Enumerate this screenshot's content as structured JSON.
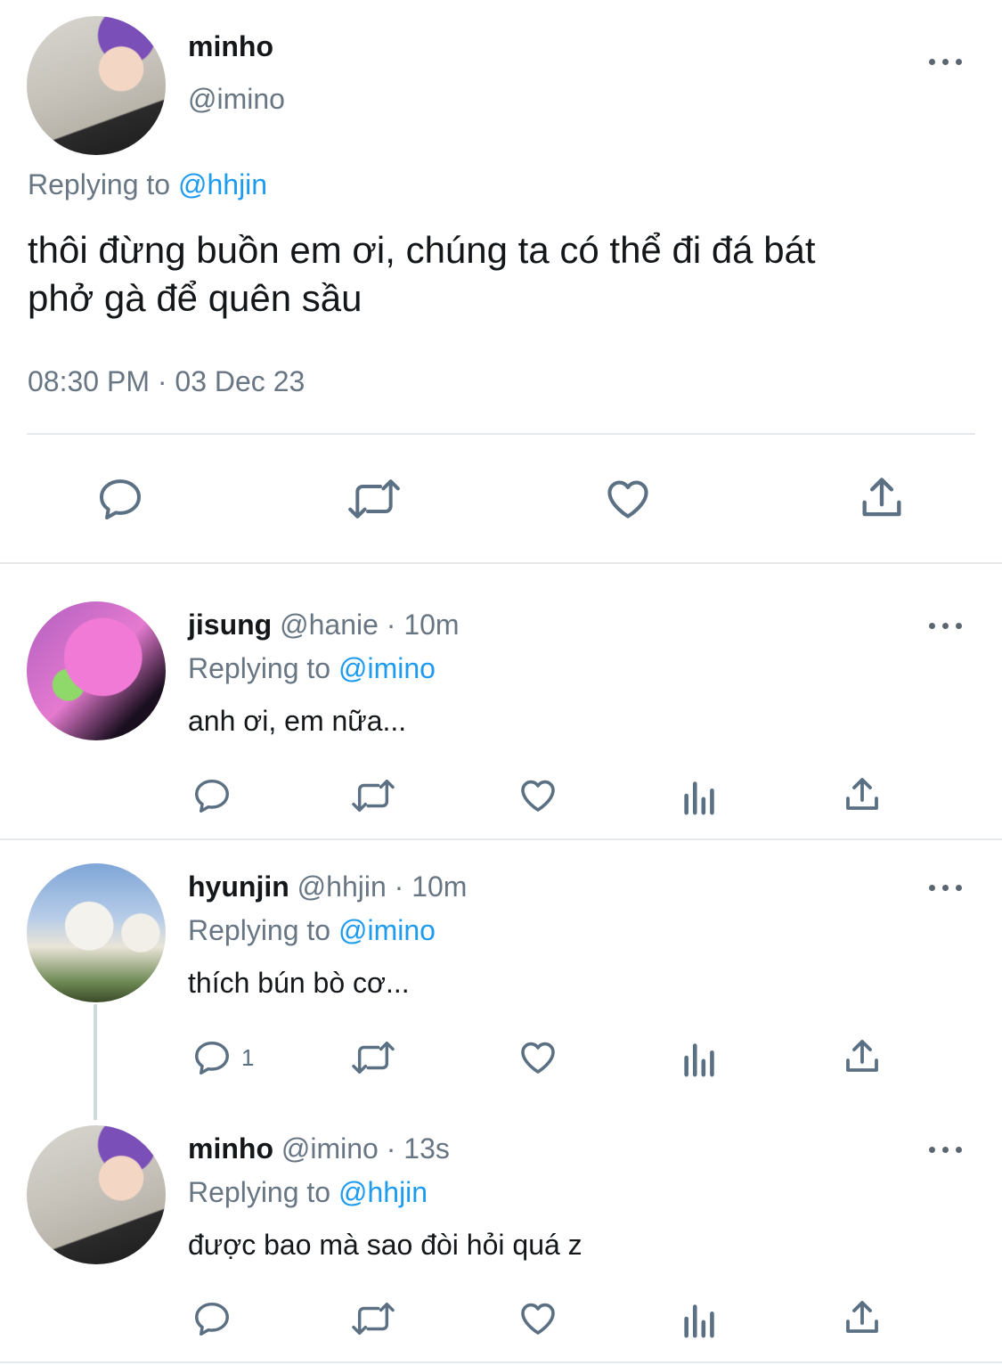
{
  "main_tweet": {
    "name": "minho",
    "handle": "@imino",
    "replying_label": "Replying to",
    "replying_to": "@hhjin",
    "text_line1": "thôi đừng buồn em ơi, chúng ta có thể đi đá bát",
    "text_line2": "phở gà để quên sầu",
    "timestamp": "08:30 PM · 03 Dec 23"
  },
  "replies": [
    {
      "name": "jisung",
      "handle": "@hanie",
      "time": "· 10m",
      "replying_label": "Replying to",
      "replying_to": "@imino",
      "text": "anh ơi, em nữa...",
      "reply_count": ""
    },
    {
      "name": "hyunjin",
      "handle": "@hhjin",
      "time": "· 10m",
      "replying_label": "Replying to",
      "replying_to": "@imino",
      "text": "thích bún bò cơ...",
      "reply_count": "1"
    },
    {
      "name": "minho",
      "handle": "@imino",
      "time": "· 13s",
      "replying_label": "Replying to",
      "replying_to": "@hhjin",
      "text": "được bao mà sao đòi hỏi quá z",
      "reply_count": ""
    }
  ],
  "colors": {
    "link": "#1d9bf0",
    "muted": "#687684",
    "icon": "#5b7083",
    "divider": "#e6e9ec"
  },
  "icons": [
    "more-icon",
    "reply-icon",
    "retweet-icon",
    "like-icon",
    "analytics-icon",
    "share-icon"
  ]
}
